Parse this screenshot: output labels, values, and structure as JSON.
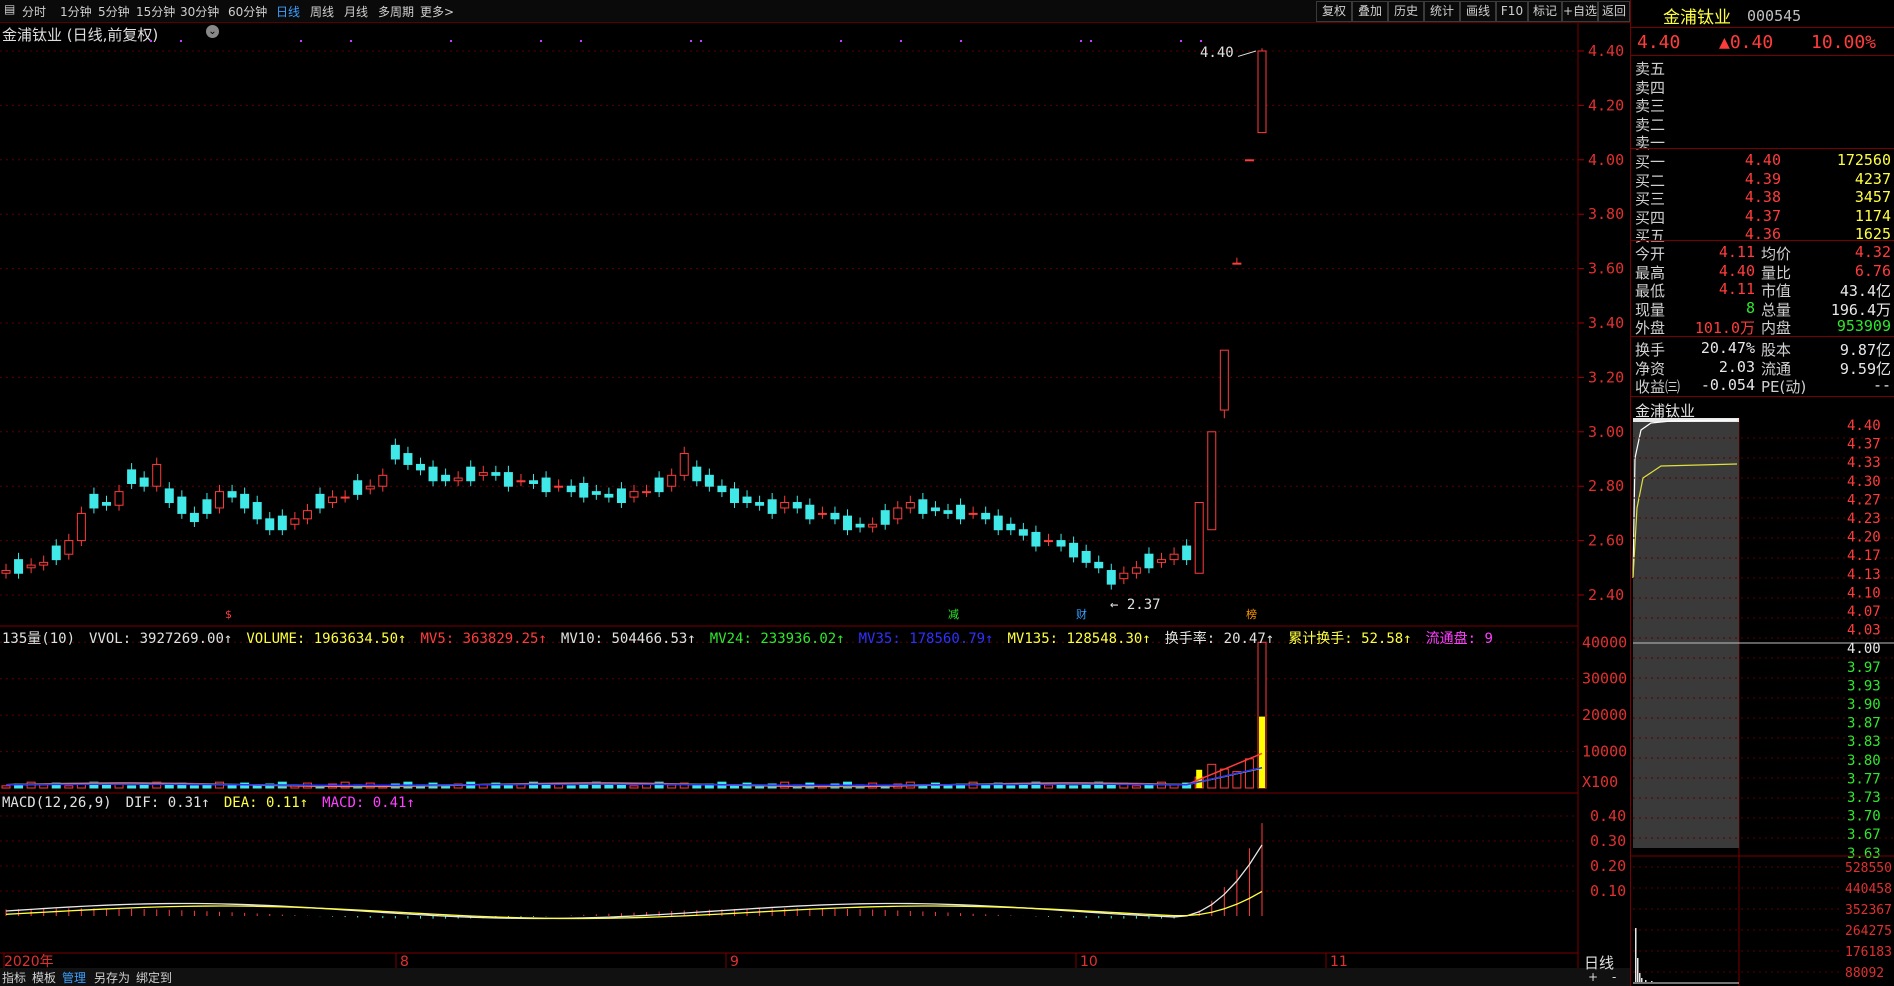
{
  "toolbar": {
    "periods": [
      "分时",
      "1分钟",
      "5分钟",
      "15分钟",
      "30分钟",
      "60分钟",
      "日线",
      "周线",
      "月线",
      "多周期",
      "更多>"
    ],
    "active_period": "日线",
    "actions": [
      "复权",
      "叠加",
      "历史",
      "统计",
      "画线",
      "F10",
      "标记",
      "+自选",
      "返回"
    ]
  },
  "chart": {
    "title": "金浦钛业 (日线,前复权)",
    "price_axis": [
      "4.40",
      "4.20",
      "4.00",
      "3.80",
      "3.60",
      "3.40",
      "3.20",
      "3.00",
      "2.80",
      "2.60",
      "2.40"
    ],
    "high_label": "4.40",
    "low_label": "2.37",
    "event_markers": [
      "$",
      "减",
      "财",
      "榜"
    ],
    "volume_indicators": [
      {
        "text": "135量(10)",
        "color": "#e0e0e0"
      },
      {
        "text": "VVOL: 3927269.00↑",
        "color": "#e0e0e0"
      },
      {
        "text": "VOLUME: 1963634.50↑",
        "color": "#ffff40"
      },
      {
        "text": "MV5: 363829.25↑",
        "color": "#ff3c3c"
      },
      {
        "text": "MV10: 504466.53↑",
        "color": "#e0e0e0"
      },
      {
        "text": "MV24: 233936.02↑",
        "color": "#2ee82e"
      },
      {
        "text": "MV35: 178560.79↑",
        "color": "#3030ff"
      },
      {
        "text": "MV135: 128548.30↑",
        "color": "#ffff40"
      },
      {
        "text": "换手率: 20.47↑",
        "color": "#e0e0e0"
      },
      {
        "text": "累计换手: 52.58↑",
        "color": "#ffff40"
      },
      {
        "text": "流通盘: 9",
        "color": "#ff40ff"
      }
    ],
    "volume_axis": [
      "40000",
      "30000",
      "20000",
      "10000",
      "X100"
    ],
    "macd_indicators": [
      {
        "text": "MACD(12,26,9)",
        "color": "#e0e0e0"
      },
      {
        "text": "DIF: 0.31↑",
        "color": "#e0e0e0"
      },
      {
        "text": "DEA: 0.11↑",
        "color": "#ffff40"
      },
      {
        "text": "MACD: 0.41↑",
        "color": "#ff40ff"
      }
    ],
    "macd_axis": [
      "0.40",
      "0.30",
      "0.20",
      "0.10"
    ],
    "time_axis": [
      "2020年",
      "8",
      "9",
      "10",
      "11"
    ],
    "period_label": "日线",
    "bottom_tabs": [
      "指标",
      "模板",
      "管理",
      "另存为",
      "绑定到"
    ],
    "active_bottom_tab": "管理"
  },
  "quote": {
    "name": "金浦钛业",
    "code": "000545",
    "price": "4.40",
    "change": "▲0.40",
    "pct": "10.00%",
    "sell": [
      {
        "label": "卖五",
        "price": "",
        "vol": ""
      },
      {
        "label": "卖四",
        "price": "",
        "vol": ""
      },
      {
        "label": "卖三",
        "price": "",
        "vol": ""
      },
      {
        "label": "卖二",
        "price": "",
        "vol": ""
      },
      {
        "label": "卖一",
        "price": "",
        "vol": ""
      }
    ],
    "buy": [
      {
        "label": "买一",
        "price": "4.40",
        "vol": "172560"
      },
      {
        "label": "买二",
        "price": "4.39",
        "vol": "4237"
      },
      {
        "label": "买三",
        "price": "4.38",
        "vol": "3457"
      },
      {
        "label": "买四",
        "price": "4.37",
        "vol": "1174"
      },
      {
        "label": "买五",
        "price": "4.36",
        "vol": "1625"
      }
    ],
    "stats": [
      {
        "l1": "今开",
        "v1": "4.11",
        "c1": "red",
        "l2": "均价",
        "v2": "4.32",
        "c2": "red"
      },
      {
        "l1": "最高",
        "v1": "4.40",
        "c1": "red",
        "l2": "量比",
        "v2": "6.76",
        "c2": "red"
      },
      {
        "l1": "最低",
        "v1": "4.11",
        "c1": "red",
        "l2": "市值",
        "v2": "43.4亿",
        "c2": "white"
      },
      {
        "l1": "现量",
        "v1": "8",
        "c1": "green",
        "l2": "总量",
        "v2": "196.4万",
        "c2": "white"
      },
      {
        "l1": "外盘",
        "v1": "101.0万",
        "c1": "red",
        "l2": "内盘",
        "v2": "953909",
        "c2": "green"
      }
    ],
    "stats2": [
      {
        "l1": "换手",
        "v1": "20.47%",
        "c1": "white",
        "l2": "股本",
        "v2": "9.87亿",
        "c2": "white"
      },
      {
        "l1": "净资",
        "v1": "2.03",
        "c1": "white",
        "l2": "流通",
        "v2": "9.59亿",
        "c2": "white"
      },
      {
        "l1": "收益㈢",
        "v1": "-0.054",
        "c1": "white",
        "l2": "PE(动)",
        "v2": "--",
        "c2": "white"
      }
    ],
    "mini_title": "金浦钛业",
    "mini_price_axis": [
      "4.40",
      "4.37",
      "4.33",
      "4.30",
      "4.27",
      "4.23",
      "4.20",
      "4.17",
      "4.13",
      "4.10",
      "4.07",
      "4.03",
      "4.00",
      "3.97",
      "3.93",
      "3.90",
      "3.87",
      "3.83",
      "3.80",
      "3.77",
      "3.73",
      "3.70",
      "3.67",
      "3.63"
    ],
    "mini_vol_axis": [
      "528550",
      "440458",
      "352367",
      "264275",
      "176183",
      "88092"
    ]
  },
  "colors": {
    "up": "#ff3c3c",
    "down": "#40e8e8",
    "grid": "#5a0000",
    "bg": "#000000"
  }
}
